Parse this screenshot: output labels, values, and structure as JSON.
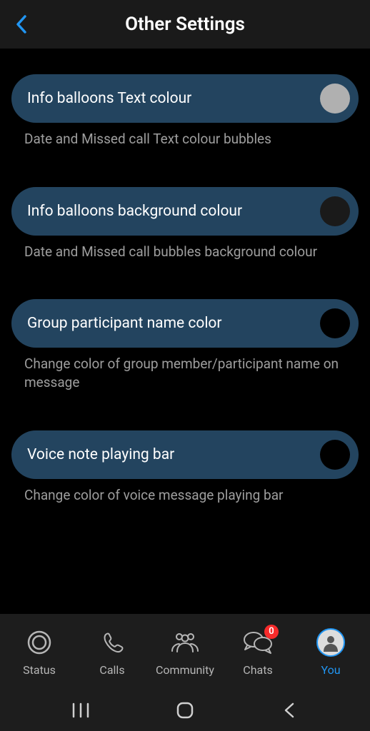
{
  "header": {
    "title": "Other Settings"
  },
  "settings": [
    {
      "label": "Info balloons Text colour",
      "description": "Date and Missed call Text colour bubbles",
      "swatch_color": "#b0b0b0"
    },
    {
      "label": "Info balloons background colour",
      "description": "Date and Missed call bubbles background colour",
      "swatch_color": "#1a1a1a"
    },
    {
      "label": "Group participant name color",
      "description": "Change color of group member/participant name on message",
      "swatch_color": "#000000"
    },
    {
      "label": "Voice note playing bar",
      "description": "Change color of voice message playing bar",
      "swatch_color": "#000000"
    }
  ],
  "tabs": {
    "status": "Status",
    "calls": "Calls",
    "community": "Community",
    "chats": "Chats",
    "you": "You",
    "chats_badge": "0"
  }
}
